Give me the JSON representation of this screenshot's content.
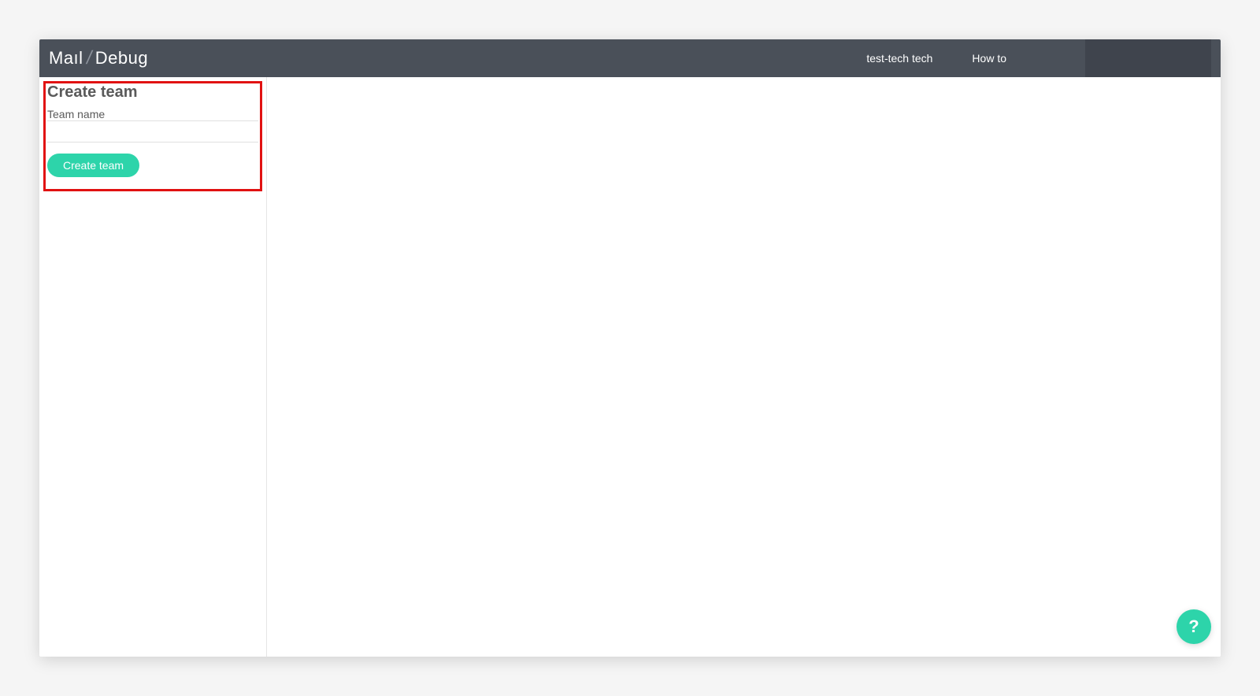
{
  "header": {
    "logo": {
      "part1": "Maıl",
      "separator": "/",
      "part2": "Debug"
    },
    "user_label": "test-tech tech",
    "howto_label": "How to"
  },
  "sidebar": {
    "panel_title": "Create team",
    "field_label": "Team name",
    "input_value": "",
    "button_label": "Create team"
  },
  "help_fab": {
    "icon_text": "?"
  },
  "colors": {
    "header_bg": "#4a5059",
    "accent": "#2dd4aa",
    "highlight_border": "#e11212"
  }
}
